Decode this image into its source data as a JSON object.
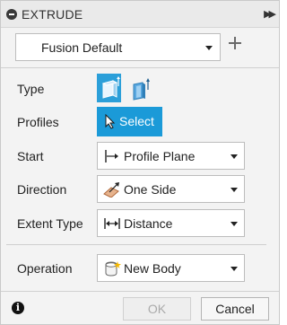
{
  "header": {
    "title": "EXTRUDE"
  },
  "preset": {
    "value": "Fusion Default"
  },
  "rows": {
    "type": {
      "label": "Type"
    },
    "profiles": {
      "label": "Profiles",
      "button_label": "Select"
    },
    "start": {
      "label": "Start",
      "value": "Profile Plane"
    },
    "direction": {
      "label": "Direction",
      "value": "One Side"
    },
    "extent_type": {
      "label": "Extent Type",
      "value": "Distance"
    },
    "operation": {
      "label": "Operation",
      "value": "New Body"
    }
  },
  "footer": {
    "ok_label": "OK",
    "cancel_label": "Cancel"
  },
  "icons": {
    "collapse": "minus-circle-icon",
    "expand": "double-chevron-right-icon",
    "add_preset": "plus-icon",
    "type_solid": "extrude-solid-icon",
    "type_thin": "extrude-thin-icon",
    "select_cursor": "cursor-arrow-icon",
    "start": "profile-plane-icon",
    "direction": "one-side-icon",
    "extent": "distance-icon",
    "operation": "new-body-icon",
    "info": "info-icon"
  },
  "colors": {
    "accent": "#1b9ad8",
    "panel_bg": "#f3f3f3",
    "disabled_text": "#aaaaaa"
  }
}
